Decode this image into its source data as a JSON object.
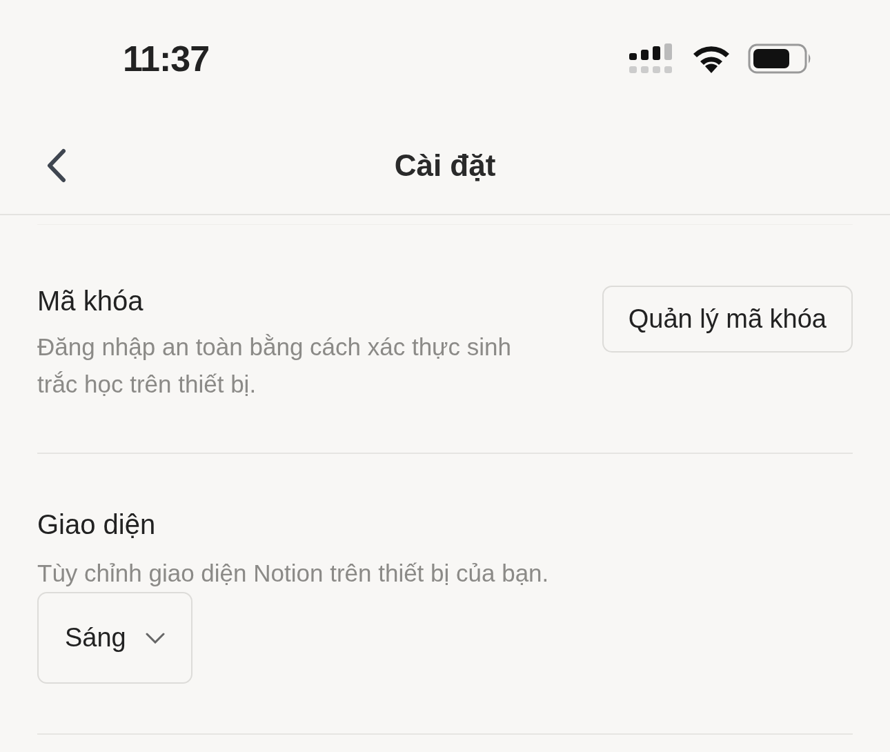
{
  "status_bar": {
    "time": "11:37"
  },
  "nav": {
    "title": "Cài đặt"
  },
  "settings": [
    {
      "kind": "button",
      "title": "Mã khóa",
      "description": "Đăng nhập an toàn bằng cách xác thực sinh trắc học trên thiết bị.",
      "control": "Quản lý mã khóa"
    },
    {
      "kind": "dropdown",
      "title": "Giao diện",
      "description": "Tùy chỉnh giao diện Notion trên thiết bị của bạn.",
      "control": "Sáng"
    }
  ]
}
